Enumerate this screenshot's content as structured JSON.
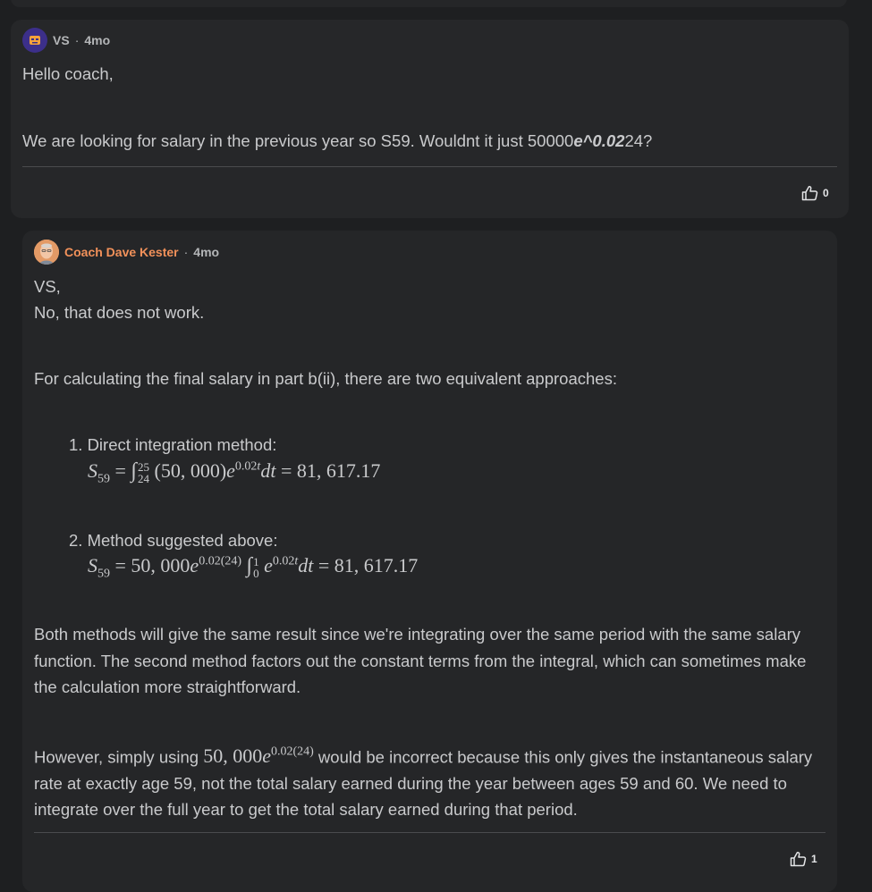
{
  "post": {
    "author": "VS",
    "age": "4mo",
    "greeting": "Hello coach,",
    "body_prefix": "We are looking for salary in the previous year so S59. Wouldnt it just 50000",
    "body_italic": "e^0.02",
    "body_suffix": "24?",
    "like_count": "0"
  },
  "reply": {
    "author": "Coach Dave Kester",
    "age": "4mo",
    "line1": "VS,",
    "line2": "No, that does not work.",
    "intro": "For calculating the final salary in part b(ii), there are two equivalent approaches:",
    "item1_label": "1. Direct integration method:",
    "item1_result": "81, 617.17",
    "item2_label": "2. Method suggested above:",
    "item2_result": "81, 617.17",
    "para1": "Both methods will give the same result since we're integrating over the same period with the same salary function. The second method factors out the constant terms from the integral, which can sometimes make the calculation more straightforward.",
    "para2_prefix": "However, simply using",
    "para2_suffix": "would be incorrect because this only gives the instantaneous salary rate at exactly age 59, not the total salary earned during the year between ages 59 and 60. We need to integrate over the full year to get the total salary earned during that period.",
    "like_count": "1"
  },
  "icons": {
    "like": "thumbs-up-icon",
    "avatar_vs": "avatar-icon",
    "avatar_coach": "coach-photo"
  },
  "colors": {
    "background": "#1e1f21",
    "card": "#262729",
    "accent_name": "#f2915a",
    "text": "#c9cacc"
  }
}
